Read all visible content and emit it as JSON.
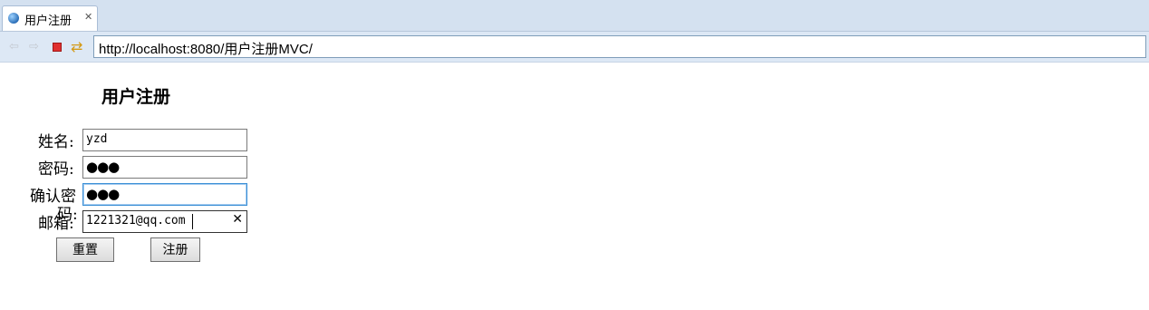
{
  "browser": {
    "tab_title": "用户注册",
    "tab_close": "✕",
    "url": "http://localhost:8080/用户注册MVC/"
  },
  "form": {
    "title": "用户注册",
    "fields": [
      {
        "label": "姓名:",
        "value": "yzd",
        "type": "text"
      },
      {
        "label": "密码:",
        "value": "●●●",
        "type": "password"
      },
      {
        "label_line1": "确认密",
        "label_line2": "码:",
        "value": "●●●",
        "type": "password"
      },
      {
        "label": "邮箱:",
        "value": "1221321@qq.com",
        "type": "email",
        "clear_glyph": "✕"
      }
    ],
    "reset_label": "重置",
    "submit_label": "注册"
  }
}
